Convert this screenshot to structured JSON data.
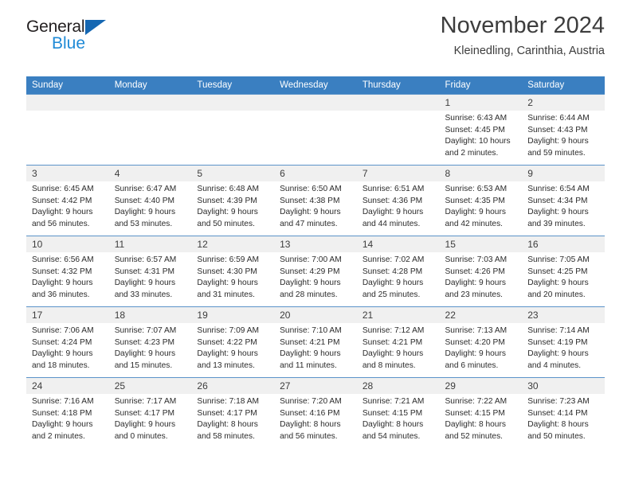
{
  "brand": {
    "name_part1": "General",
    "name_part2": "Blue",
    "triangle_icon": "triangle-icon",
    "accent_dark": "#231f20",
    "accent_blue": "#1f8ad6",
    "triangle_blue": "#1567b2"
  },
  "header": {
    "title": "November 2024",
    "subtitle": "Kleinedling, Carinthia, Austria",
    "header_bg": "#3a7fc1",
    "daynum_bg": "#f0f0f0",
    "row_rule": "#5b93c9"
  },
  "weekdays": [
    "Sunday",
    "Monday",
    "Tuesday",
    "Wednesday",
    "Thursday",
    "Friday",
    "Saturday"
  ],
  "weeks": [
    [
      {
        "day": "",
        "sunrise": "",
        "sunset": "",
        "daylight1": "",
        "daylight2": ""
      },
      {
        "day": "",
        "sunrise": "",
        "sunset": "",
        "daylight1": "",
        "daylight2": ""
      },
      {
        "day": "",
        "sunrise": "",
        "sunset": "",
        "daylight1": "",
        "daylight2": ""
      },
      {
        "day": "",
        "sunrise": "",
        "sunset": "",
        "daylight1": "",
        "daylight2": ""
      },
      {
        "day": "",
        "sunrise": "",
        "sunset": "",
        "daylight1": "",
        "daylight2": ""
      },
      {
        "day": "1",
        "sunrise": "Sunrise: 6:43 AM",
        "sunset": "Sunset: 4:45 PM",
        "daylight1": "Daylight: 10 hours",
        "daylight2": "and 2 minutes."
      },
      {
        "day": "2",
        "sunrise": "Sunrise: 6:44 AM",
        "sunset": "Sunset: 4:43 PM",
        "daylight1": "Daylight: 9 hours",
        "daylight2": "and 59 minutes."
      }
    ],
    [
      {
        "day": "3",
        "sunrise": "Sunrise: 6:45 AM",
        "sunset": "Sunset: 4:42 PM",
        "daylight1": "Daylight: 9 hours",
        "daylight2": "and 56 minutes."
      },
      {
        "day": "4",
        "sunrise": "Sunrise: 6:47 AM",
        "sunset": "Sunset: 4:40 PM",
        "daylight1": "Daylight: 9 hours",
        "daylight2": "and 53 minutes."
      },
      {
        "day": "5",
        "sunrise": "Sunrise: 6:48 AM",
        "sunset": "Sunset: 4:39 PM",
        "daylight1": "Daylight: 9 hours",
        "daylight2": "and 50 minutes."
      },
      {
        "day": "6",
        "sunrise": "Sunrise: 6:50 AM",
        "sunset": "Sunset: 4:38 PM",
        "daylight1": "Daylight: 9 hours",
        "daylight2": "and 47 minutes."
      },
      {
        "day": "7",
        "sunrise": "Sunrise: 6:51 AM",
        "sunset": "Sunset: 4:36 PM",
        "daylight1": "Daylight: 9 hours",
        "daylight2": "and 44 minutes."
      },
      {
        "day": "8",
        "sunrise": "Sunrise: 6:53 AM",
        "sunset": "Sunset: 4:35 PM",
        "daylight1": "Daylight: 9 hours",
        "daylight2": "and 42 minutes."
      },
      {
        "day": "9",
        "sunrise": "Sunrise: 6:54 AM",
        "sunset": "Sunset: 4:34 PM",
        "daylight1": "Daylight: 9 hours",
        "daylight2": "and 39 minutes."
      }
    ],
    [
      {
        "day": "10",
        "sunrise": "Sunrise: 6:56 AM",
        "sunset": "Sunset: 4:32 PM",
        "daylight1": "Daylight: 9 hours",
        "daylight2": "and 36 minutes."
      },
      {
        "day": "11",
        "sunrise": "Sunrise: 6:57 AM",
        "sunset": "Sunset: 4:31 PM",
        "daylight1": "Daylight: 9 hours",
        "daylight2": "and 33 minutes."
      },
      {
        "day": "12",
        "sunrise": "Sunrise: 6:59 AM",
        "sunset": "Sunset: 4:30 PM",
        "daylight1": "Daylight: 9 hours",
        "daylight2": "and 31 minutes."
      },
      {
        "day": "13",
        "sunrise": "Sunrise: 7:00 AM",
        "sunset": "Sunset: 4:29 PM",
        "daylight1": "Daylight: 9 hours",
        "daylight2": "and 28 minutes."
      },
      {
        "day": "14",
        "sunrise": "Sunrise: 7:02 AM",
        "sunset": "Sunset: 4:28 PM",
        "daylight1": "Daylight: 9 hours",
        "daylight2": "and 25 minutes."
      },
      {
        "day": "15",
        "sunrise": "Sunrise: 7:03 AM",
        "sunset": "Sunset: 4:26 PM",
        "daylight1": "Daylight: 9 hours",
        "daylight2": "and 23 minutes."
      },
      {
        "day": "16",
        "sunrise": "Sunrise: 7:05 AM",
        "sunset": "Sunset: 4:25 PM",
        "daylight1": "Daylight: 9 hours",
        "daylight2": "and 20 minutes."
      }
    ],
    [
      {
        "day": "17",
        "sunrise": "Sunrise: 7:06 AM",
        "sunset": "Sunset: 4:24 PM",
        "daylight1": "Daylight: 9 hours",
        "daylight2": "and 18 minutes."
      },
      {
        "day": "18",
        "sunrise": "Sunrise: 7:07 AM",
        "sunset": "Sunset: 4:23 PM",
        "daylight1": "Daylight: 9 hours",
        "daylight2": "and 15 minutes."
      },
      {
        "day": "19",
        "sunrise": "Sunrise: 7:09 AM",
        "sunset": "Sunset: 4:22 PM",
        "daylight1": "Daylight: 9 hours",
        "daylight2": "and 13 minutes."
      },
      {
        "day": "20",
        "sunrise": "Sunrise: 7:10 AM",
        "sunset": "Sunset: 4:21 PM",
        "daylight1": "Daylight: 9 hours",
        "daylight2": "and 11 minutes."
      },
      {
        "day": "21",
        "sunrise": "Sunrise: 7:12 AM",
        "sunset": "Sunset: 4:21 PM",
        "daylight1": "Daylight: 9 hours",
        "daylight2": "and 8 minutes."
      },
      {
        "day": "22",
        "sunrise": "Sunrise: 7:13 AM",
        "sunset": "Sunset: 4:20 PM",
        "daylight1": "Daylight: 9 hours",
        "daylight2": "and 6 minutes."
      },
      {
        "day": "23",
        "sunrise": "Sunrise: 7:14 AM",
        "sunset": "Sunset: 4:19 PM",
        "daylight1": "Daylight: 9 hours",
        "daylight2": "and 4 minutes."
      }
    ],
    [
      {
        "day": "24",
        "sunrise": "Sunrise: 7:16 AM",
        "sunset": "Sunset: 4:18 PM",
        "daylight1": "Daylight: 9 hours",
        "daylight2": "and 2 minutes."
      },
      {
        "day": "25",
        "sunrise": "Sunrise: 7:17 AM",
        "sunset": "Sunset: 4:17 PM",
        "daylight1": "Daylight: 9 hours",
        "daylight2": "and 0 minutes."
      },
      {
        "day": "26",
        "sunrise": "Sunrise: 7:18 AM",
        "sunset": "Sunset: 4:17 PM",
        "daylight1": "Daylight: 8 hours",
        "daylight2": "and 58 minutes."
      },
      {
        "day": "27",
        "sunrise": "Sunrise: 7:20 AM",
        "sunset": "Sunset: 4:16 PM",
        "daylight1": "Daylight: 8 hours",
        "daylight2": "and 56 minutes."
      },
      {
        "day": "28",
        "sunrise": "Sunrise: 7:21 AM",
        "sunset": "Sunset: 4:15 PM",
        "daylight1": "Daylight: 8 hours",
        "daylight2": "and 54 minutes."
      },
      {
        "day": "29",
        "sunrise": "Sunrise: 7:22 AM",
        "sunset": "Sunset: 4:15 PM",
        "daylight1": "Daylight: 8 hours",
        "daylight2": "and 52 minutes."
      },
      {
        "day": "30",
        "sunrise": "Sunrise: 7:23 AM",
        "sunset": "Sunset: 4:14 PM",
        "daylight1": "Daylight: 8 hours",
        "daylight2": "and 50 minutes."
      }
    ]
  ]
}
